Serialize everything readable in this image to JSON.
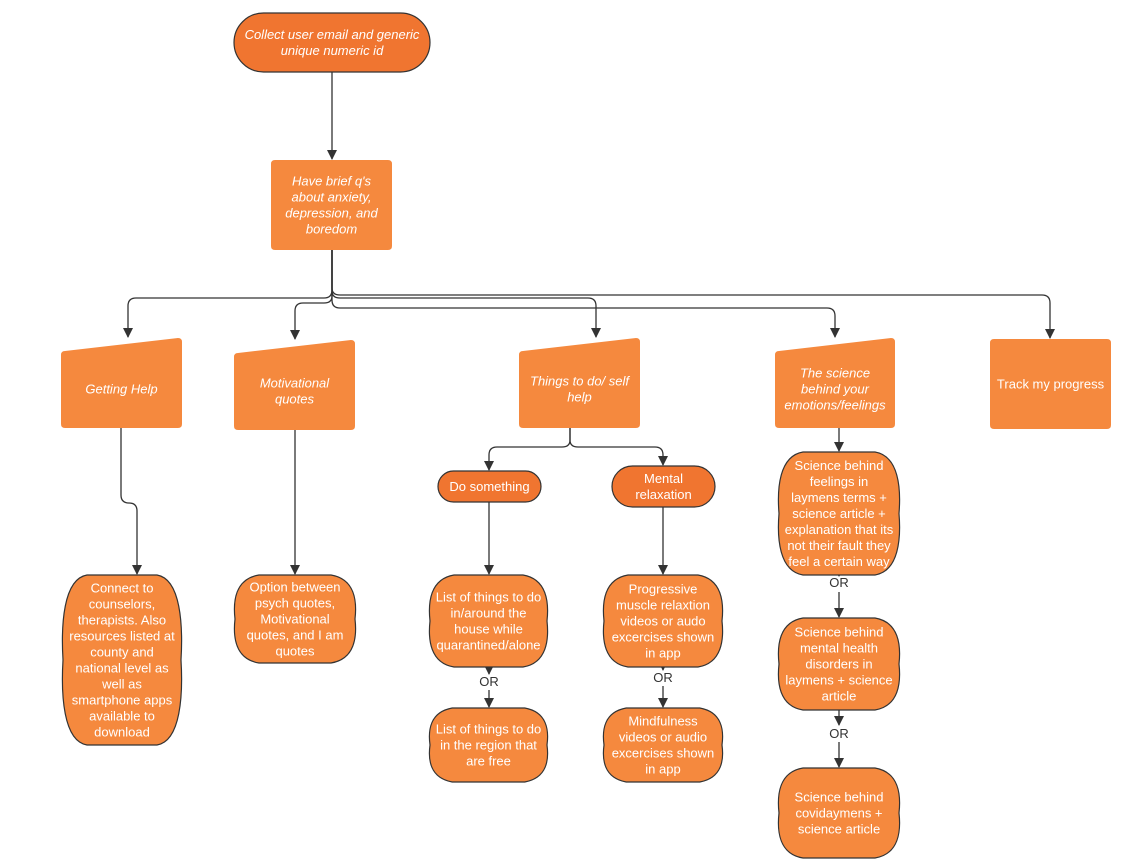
{
  "colors": {
    "fill_light": "#F5893E",
    "fill_dark": "#F07530",
    "stroke": "#333333",
    "text": "#FFFFFF"
  },
  "nodes": {
    "start": {
      "shape": "terminator",
      "italic": true,
      "lines": [
        "Collect user email and generic",
        "unique numeric id"
      ]
    },
    "questions": {
      "shape": "process",
      "italic": true,
      "lines": [
        "Have brief q's",
        "about anxiety,",
        "depression, and",
        "boredom"
      ]
    },
    "getting_help": {
      "shape": "manual-input",
      "italic": true,
      "lines": [
        "Getting Help"
      ]
    },
    "motivational": {
      "shape": "manual-input",
      "italic": true,
      "lines": [
        "Motivational",
        "quotes"
      ]
    },
    "things_to_do": {
      "shape": "manual-input",
      "italic": true,
      "lines": [
        "Things to do/ self",
        "help"
      ]
    },
    "science": {
      "shape": "manual-input",
      "italic": true,
      "lines": [
        "The science",
        "behind your",
        "emotions/feelings"
      ]
    },
    "track": {
      "shape": "process",
      "italic": false,
      "lines": [
        "Track my progress"
      ]
    },
    "connect": {
      "shape": "barrel",
      "italic": false,
      "lines": [
        "Connect to",
        "counselors,",
        "therapists. Also",
        "resources listed at",
        "county and",
        "national level as",
        "well as",
        "smartphone apps",
        "available to",
        "download"
      ]
    },
    "option_quotes": {
      "shape": "barrel",
      "italic": false,
      "lines": [
        "Option between",
        "psych quotes,",
        "Motivational",
        "quotes, and I am",
        "quotes"
      ]
    },
    "do_something": {
      "shape": "terminator",
      "italic": false,
      "lines": [
        "Do something"
      ]
    },
    "mental_relax": {
      "shape": "terminator",
      "italic": false,
      "lines": [
        "Mental",
        "relaxation"
      ]
    },
    "list_house": {
      "shape": "barrel",
      "italic": false,
      "lines": [
        "List of things to do",
        "in/around the",
        "house while",
        "quarantined/alone"
      ]
    },
    "list_region": {
      "shape": "barrel",
      "italic": false,
      "lines": [
        "List of things to do",
        "in the region that",
        "are free"
      ]
    },
    "progressive": {
      "shape": "barrel",
      "italic": false,
      "lines": [
        "Progressive",
        "muscle relaxtion",
        "videos or audo",
        "excercises shown",
        "in app"
      ]
    },
    "mindfulness": {
      "shape": "barrel",
      "italic": false,
      "lines": [
        "Mindfulness",
        "videos or audio",
        "excercises shown",
        "in app"
      ]
    },
    "sci_feelings": {
      "shape": "barrel",
      "italic": false,
      "lines": [
        "Science behind",
        "feelings in",
        "laymens terms +",
        "science article +",
        "explanation that its",
        "not their fault they",
        "feel a certain way"
      ]
    },
    "sci_disorders": {
      "shape": "barrel",
      "italic": false,
      "lines": [
        "Science behind",
        "mental health",
        "disorders in",
        "laymens + science",
        "article"
      ]
    },
    "sci_covid": {
      "shape": "barrel",
      "italic": false,
      "lines": [
        "Science behind",
        "covidaymens +",
        "science article"
      ]
    }
  },
  "edge_labels": {
    "or": "OR"
  }
}
